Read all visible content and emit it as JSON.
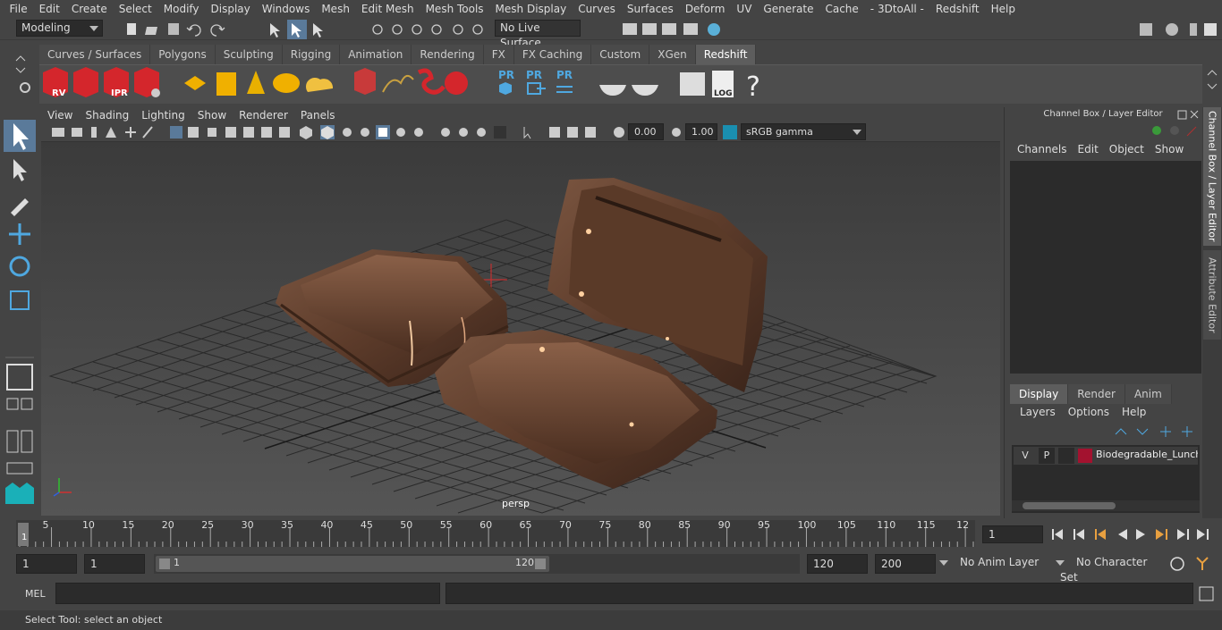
{
  "menubar": [
    "File",
    "Edit",
    "Create",
    "Select",
    "Modify",
    "Display",
    "Windows",
    "Mesh",
    "Edit Mesh",
    "Mesh Tools",
    "Mesh Display",
    "Curves",
    "Surfaces",
    "Deform",
    "UV",
    "Generate",
    "Cache",
    "- 3DtoAll -",
    "Redshift",
    "Help"
  ],
  "status": {
    "workspace": "Modeling",
    "live_surface": "No Live Surface"
  },
  "shelf_tabs": [
    "Curves / Surfaces",
    "Polygons",
    "Sculpting",
    "Rigging",
    "Animation",
    "Rendering",
    "FX",
    "FX Caching",
    "Custom",
    "XGen",
    "Redshift"
  ],
  "shelf_active": "Redshift",
  "shelf_labels": {
    "rv": "RV",
    "ipr": "IPR",
    "pr1": "PR",
    "pr2": "PR",
    "pr3": "PR",
    "log": "LOG",
    "help": "?"
  },
  "viewport": {
    "menus": [
      "View",
      "Shading",
      "Lighting",
      "Show",
      "Renderer",
      "Panels"
    ],
    "exposure": "0.00",
    "gamma": "1.00",
    "color_space": "sRGB gamma",
    "camera_label": "persp"
  },
  "channel_box": {
    "title": "Channel Box / Layer Editor",
    "menus": [
      "Channels",
      "Edit",
      "Object",
      "Show"
    ],
    "layer_tabs": [
      "Display",
      "Render",
      "Anim"
    ],
    "layer_menus": [
      "Layers",
      "Options",
      "Help"
    ],
    "layer": {
      "v": "V",
      "p": "P",
      "name": "Biodegradable_Lunch_",
      "color": "#a3122f"
    },
    "side_tabs": [
      "Channel Box / Layer Editor",
      "Attribute Editor"
    ]
  },
  "timeline": {
    "ticks": [
      "5",
      "10",
      "15",
      "20",
      "25",
      "30",
      "35",
      "40",
      "45",
      "50",
      "55",
      "60",
      "65",
      "70",
      "75",
      "80",
      "85",
      "90",
      "95",
      "100",
      "105",
      "110",
      "115",
      "12"
    ],
    "current_marker": "1",
    "current_frame": "1"
  },
  "range": {
    "start": "1",
    "playback_start": "1",
    "slider_start": "1",
    "slider_end": "120",
    "playback_end": "120",
    "end": "200",
    "anim_layer": "No Anim Layer",
    "character_set": "No Character Set"
  },
  "cmd": {
    "lang": "MEL"
  },
  "help_text": "Select Tool: select an object"
}
